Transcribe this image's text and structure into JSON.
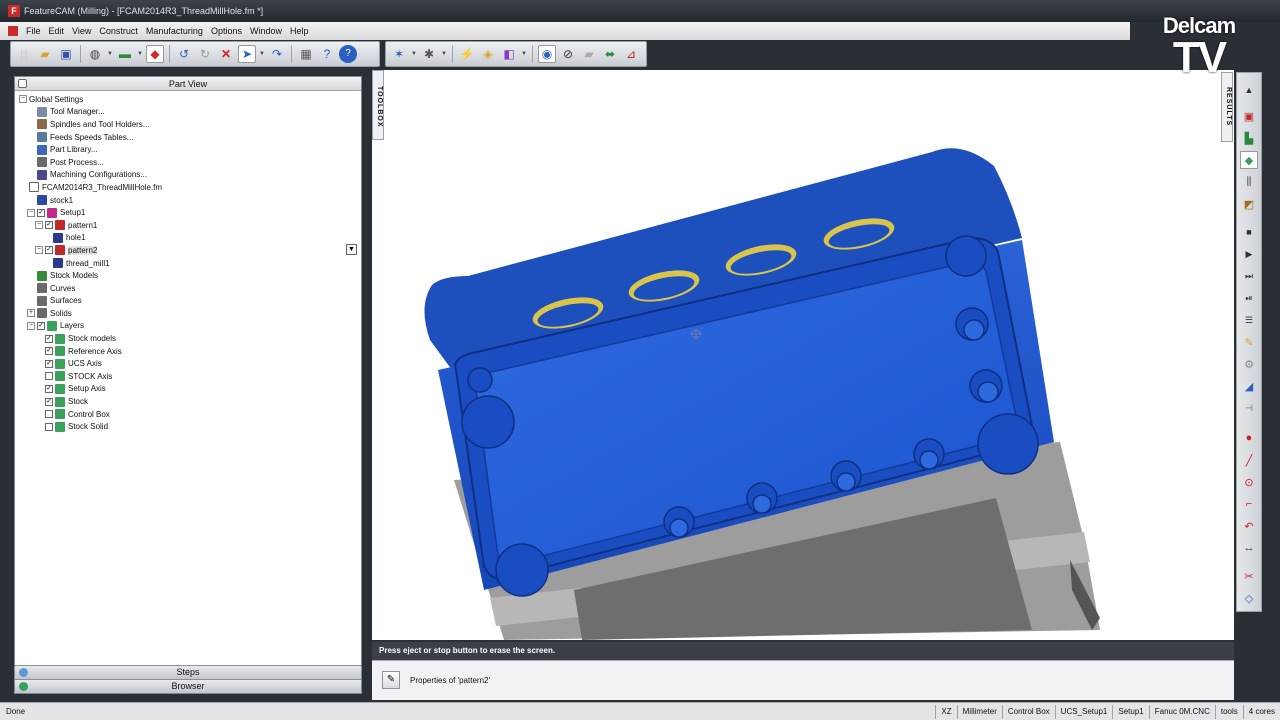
{
  "window": {
    "title": "FeatureCAM (Milling) - [FCAM2014R3_ThreadMillHole.fm *]"
  },
  "brand": {
    "top": "Delcam",
    "bottom": "TV"
  },
  "menu": [
    "File",
    "Edit",
    "View",
    "Construct",
    "Manufacturing",
    "Options",
    "Window",
    "Help"
  ],
  "toolbar": {
    "buttons": [
      "new-icon",
      "open-icon",
      "save-icon",
      "globe-icon",
      "color-icon",
      "erase-icon",
      "undo-icon",
      "redo-icon",
      "delete-icon",
      "select-arrow-icon",
      "rotate-icon",
      "calculator-icon",
      "help-query-icon",
      "help-icon",
      "star-icon",
      "wizard-icon",
      "magic-icon",
      "paint-icon",
      "box-icon",
      "feature-icon",
      "measure-icon",
      "ruler-icon",
      "tool-path-icon",
      "probe-icon"
    ]
  },
  "part_view": {
    "header": "Part View",
    "tree": [
      {
        "label": "Global Settings",
        "level": 0,
        "expander": "−",
        "icon": "none"
      },
      {
        "label": "Tool Manager...",
        "level": 1,
        "icon": "tool-manager-icon"
      },
      {
        "label": "Spindles and Tool Holders...",
        "level": 1,
        "icon": "spindle-icon"
      },
      {
        "label": "Feeds  Speeds Tables...",
        "level": 1,
        "icon": "table-icon"
      },
      {
        "label": "Part Library...",
        "level": 1,
        "icon": "library-icon"
      },
      {
        "label": "Post Process...",
        "level": 1,
        "icon": "post-icon"
      },
      {
        "label": "Machining Configurations...",
        "level": 1,
        "icon": "config-icon"
      },
      {
        "label": "FCAM2014R3_ThreadMillHole.fm",
        "level": 0,
        "icon": "document-icon"
      },
      {
        "label": "stock1",
        "level": 1,
        "icon": "stock-icon"
      },
      {
        "label": "Setup1",
        "level": 1,
        "expander": "−",
        "checkbox": "✓",
        "icon": "setup-icon"
      },
      {
        "label": "pattern1",
        "level": 2,
        "expander": "−",
        "checkbox": "✓",
        "icon": "pattern-icon"
      },
      {
        "label": "hole1",
        "level": 3,
        "icon": "hole-icon"
      },
      {
        "label": "pattern2",
        "level": 2,
        "expander": "−",
        "checkbox": "✓",
        "icon": "pattern-icon",
        "selected": true
      },
      {
        "label": "thread_mill1",
        "level": 3,
        "icon": "thread-mill-icon"
      },
      {
        "label": "Stock Models",
        "level": 1,
        "icon": "stock-models-icon"
      },
      {
        "label": "Curves",
        "level": 1,
        "icon": "curve-icon"
      },
      {
        "label": "Surfaces",
        "level": 1,
        "icon": "surface-icon"
      },
      {
        "label": "Solids",
        "level": 1,
        "expander": "+",
        "icon": "solid-icon"
      },
      {
        "label": "Layers",
        "level": 1,
        "expander": "−",
        "checkbox": "✓",
        "icon": "layers-icon"
      },
      {
        "label": "Stock models",
        "level": 2,
        "checkbox": "✓",
        "icon": "layer-icon"
      },
      {
        "label": "Reference Axis",
        "level": 2,
        "checkbox": "✓",
        "icon": "layer-icon"
      },
      {
        "label": "UCS Axis",
        "level": 2,
        "checkbox": "✓",
        "icon": "layer-icon"
      },
      {
        "label": "STOCK Axis",
        "level": 2,
        "checkbox": "",
        "icon": "layer-icon"
      },
      {
        "label": "Setup Axis",
        "level": 2,
        "checkbox": "✓",
        "icon": "layer-icon"
      },
      {
        "label": "Stock",
        "level": 2,
        "checkbox": "✓",
        "icon": "layer-icon"
      },
      {
        "label": "Control Box",
        "level": 2,
        "checkbox": "",
        "icon": "layer-icon"
      },
      {
        "label": "Stock Solid",
        "level": 2,
        "checkbox": "",
        "icon": "layer-icon"
      }
    ],
    "tabs": [
      "Steps",
      "Browser"
    ]
  },
  "toolbox_label": "TOOLBOX",
  "results_label": "RESULTS",
  "message": "Press eject or stop button to erase the screen.",
  "properties": "Properties of 'pattern2'",
  "status": {
    "left": "Done",
    "cells": [
      "XZ",
      "Millimeter",
      "Control Box",
      "UCS_Setup1",
      "Setup1",
      "Fanuc 0M.CNC",
      "tools",
      "4 cores"
    ]
  },
  "colors": {
    "part_blue": "#1a52c9",
    "fixture_gray": "#9a9a9a",
    "thread_gold": "#d8c44a"
  }
}
